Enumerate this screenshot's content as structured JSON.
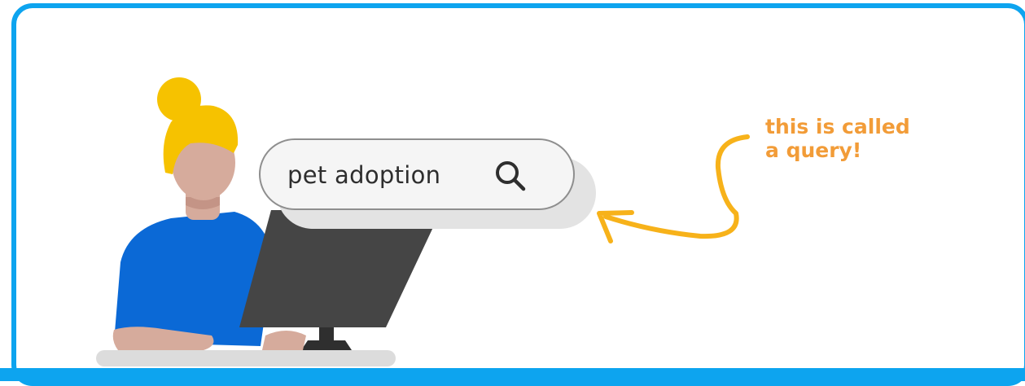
{
  "search": {
    "query": "pet adoption",
    "icon": "search-icon"
  },
  "annotation": {
    "line1": "this is called",
    "line2": "a query!"
  },
  "colors": {
    "frame_border": "#0da4ef",
    "annotation": "#f29c38",
    "arrow": "#f7b21a",
    "hair": "#f6c200",
    "skin": "#d6ab9c",
    "shirt": "#0b69d6",
    "monitor": "#454545",
    "search_bg": "#f5f5f5"
  }
}
